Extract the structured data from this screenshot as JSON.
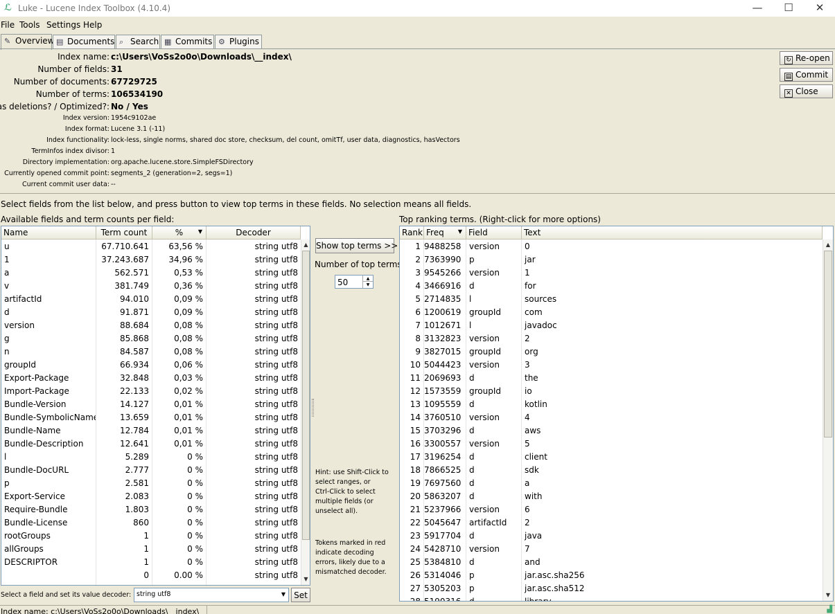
{
  "window": {
    "title": "Luke - Lucene Index Toolbox (4.10.4)",
    "minimize": "—",
    "maximize": "☐",
    "close": "✕"
  },
  "menu": [
    "File",
    "Tools",
    "Settings",
    "Help"
  ],
  "tabs": [
    {
      "label": "Overview",
      "icon": "overview-icon"
    },
    {
      "label": "Documents",
      "icon": "documents-icon"
    },
    {
      "label": "Search",
      "icon": "search-icon"
    },
    {
      "label": "Commits",
      "icon": "commits-icon"
    },
    {
      "label": "Plugins",
      "icon": "plugins-icon"
    }
  ],
  "overview": {
    "index_name": {
      "label": "Index name:",
      "value": "c:\\Users\\VoSs2o0o\\Downloads\\__index\\"
    },
    "num_fields": {
      "label": "Number of fields:",
      "value": "31"
    },
    "num_docs": {
      "label": "Number of documents:",
      "value": "67729725"
    },
    "num_terms": {
      "label": "Number of terms:",
      "value": "106534190"
    },
    "deletions": {
      "label": "Has deletions? / Optimized?:",
      "value": "No / Yes"
    },
    "details": [
      {
        "label": "Index version:",
        "value": "1954c9102ae"
      },
      {
        "label": "Index format:",
        "value": "Lucene 3.1 (-11)"
      },
      {
        "label": "Index functionality:",
        "value": "lock-less, single norms, shared doc store, checksum, del count, omitTf, user data, diagnostics, hasVectors"
      },
      {
        "label": "TermInfos index divisor:",
        "value": "1"
      },
      {
        "label": "Directory implementation:",
        "value": "org.apache.lucene.store.SimpleFSDirectory"
      },
      {
        "label": "Currently opened commit point:",
        "value": "segments_2 (generation=2, segs=1)"
      },
      {
        "label": "Current commit user data:",
        "value": "--"
      }
    ]
  },
  "side_buttons": [
    {
      "label": "Re-open",
      "icon": "↻"
    },
    {
      "label": "Commit",
      "icon": "▤"
    },
    {
      "label": "Close",
      "icon": "✕"
    }
  ],
  "instructions": "Select fields from the list below, and press button to view top terms in these fields. No selection means all fields.",
  "fields_panel": {
    "title": "Available fields and term counts per field:",
    "columns": [
      "Name",
      "Term count",
      "%",
      "Decoder"
    ],
    "rows": [
      [
        "u",
        "67.710.641",
        "63,56 %",
        "string utf8"
      ],
      [
        "1",
        "37.243.687",
        "34,96 %",
        "string utf8"
      ],
      [
        "a",
        "562.571",
        "0,53 %",
        "string utf8"
      ],
      [
        "v",
        "381.749",
        "0,36 %",
        "string utf8"
      ],
      [
        "artifactId",
        "94.010",
        "0,09 %",
        "string utf8"
      ],
      [
        "d",
        "91.871",
        "0,09 %",
        "string utf8"
      ],
      [
        "version",
        "88.684",
        "0,08 %",
        "string utf8"
      ],
      [
        "g",
        "85.868",
        "0,08 %",
        "string utf8"
      ],
      [
        "n",
        "84.587",
        "0,08 %",
        "string utf8"
      ],
      [
        "groupId",
        "66.934",
        "0,06 %",
        "string utf8"
      ],
      [
        "Export-Package",
        "32.848",
        "0,03 %",
        "string utf8"
      ],
      [
        "Import-Package",
        "22.133",
        "0,02 %",
        "string utf8"
      ],
      [
        "Bundle-Version",
        "14.127",
        "0,01 %",
        "string utf8"
      ],
      [
        "Bundle-SymbolicName",
        "13.659",
        "0,01 %",
        "string utf8"
      ],
      [
        "Bundle-Name",
        "12.784",
        "0,01 %",
        "string utf8"
      ],
      [
        "Bundle-Description",
        "12.641",
        "0,01 %",
        "string utf8"
      ],
      [
        "l",
        "5.289",
        "0 %",
        "string utf8"
      ],
      [
        "Bundle-DocURL",
        "2.777",
        "0 %",
        "string utf8"
      ],
      [
        "p",
        "2.581",
        "0 %",
        "string utf8"
      ],
      [
        "Export-Service",
        "2.083",
        "0 %",
        "string utf8"
      ],
      [
        "Require-Bundle",
        "1.803",
        "0 %",
        "string utf8"
      ],
      [
        "Bundle-License",
        "860",
        "0 %",
        "string utf8"
      ],
      [
        "rootGroups",
        "1",
        "0 %",
        "string utf8"
      ],
      [
        "allGroups",
        "1",
        "0 %",
        "string utf8"
      ],
      [
        "DESCRIPTOR",
        "1",
        "0 %",
        "string utf8"
      ],
      [
        "",
        "0",
        "0.00 %",
        "string utf8"
      ]
    ],
    "decoder_label": "Select a field and set its value decoder:",
    "decoder_value": "string utf8",
    "set_button": "Set"
  },
  "middle": {
    "show_top_terms": "Show top terms >>",
    "num_top_label": "Number of top terms:",
    "num_top_value": "50",
    "hint": "Hint: use Shift-Click to\nselect ranges, or\nCtrl-Click to select\nmultiple fields (or\nunselect all).",
    "tokens_note": "Tokens marked in red\nindicate decoding\nerrors, likely due to a\nmismatched decoder."
  },
  "terms_panel": {
    "title": "Top ranking terms. (Right-click for more options)",
    "columns": [
      "Rank",
      "Freq",
      "Field",
      "Text"
    ],
    "rows": [
      [
        "1",
        "9488258",
        "version",
        "0"
      ],
      [
        "2",
        "7363990",
        "p",
        "jar"
      ],
      [
        "3",
        "9545266",
        "version",
        "1"
      ],
      [
        "4",
        "3466916",
        "d",
        "for"
      ],
      [
        "5",
        "2714835",
        "l",
        "sources"
      ],
      [
        "6",
        "1200619",
        "groupId",
        "com"
      ],
      [
        "7",
        "1012671",
        "l",
        "javadoc"
      ],
      [
        "8",
        "3132823",
        "version",
        "2"
      ],
      [
        "9",
        "3827015",
        "groupId",
        "org"
      ],
      [
        "10",
        "5044423",
        "version",
        "3"
      ],
      [
        "11",
        "2069693",
        "d",
        "the"
      ],
      [
        "12",
        "1573559",
        "groupId",
        "io"
      ],
      [
        "13",
        "1095559",
        "d",
        "kotlin"
      ],
      [
        "14",
        "3760510",
        "version",
        "4"
      ],
      [
        "15",
        "3703296",
        "d",
        "aws"
      ],
      [
        "16",
        "3300557",
        "version",
        "5"
      ],
      [
        "17",
        "3196254",
        "d",
        "client"
      ],
      [
        "18",
        "7866525",
        "d",
        "sdk"
      ],
      [
        "19",
        "7697560",
        "d",
        "a"
      ],
      [
        "20",
        "5863207",
        "d",
        "with"
      ],
      [
        "21",
        "5237966",
        "version",
        "6"
      ],
      [
        "22",
        "5045647",
        "artifactId",
        "2"
      ],
      [
        "23",
        "5917704",
        "d",
        "java"
      ],
      [
        "24",
        "5428710",
        "version",
        "7"
      ],
      [
        "25",
        "5384810",
        "d",
        "and"
      ],
      [
        "26",
        "5314046",
        "p",
        "jar.asc.sha256"
      ],
      [
        "27",
        "5305203",
        "p",
        "jar.asc.sha512"
      ],
      [
        "28",
        "5190316",
        "d",
        "library"
      ]
    ]
  },
  "status": "Index name: c:\\Users\\VoSs2o0o\\Downloads\\__index\\"
}
